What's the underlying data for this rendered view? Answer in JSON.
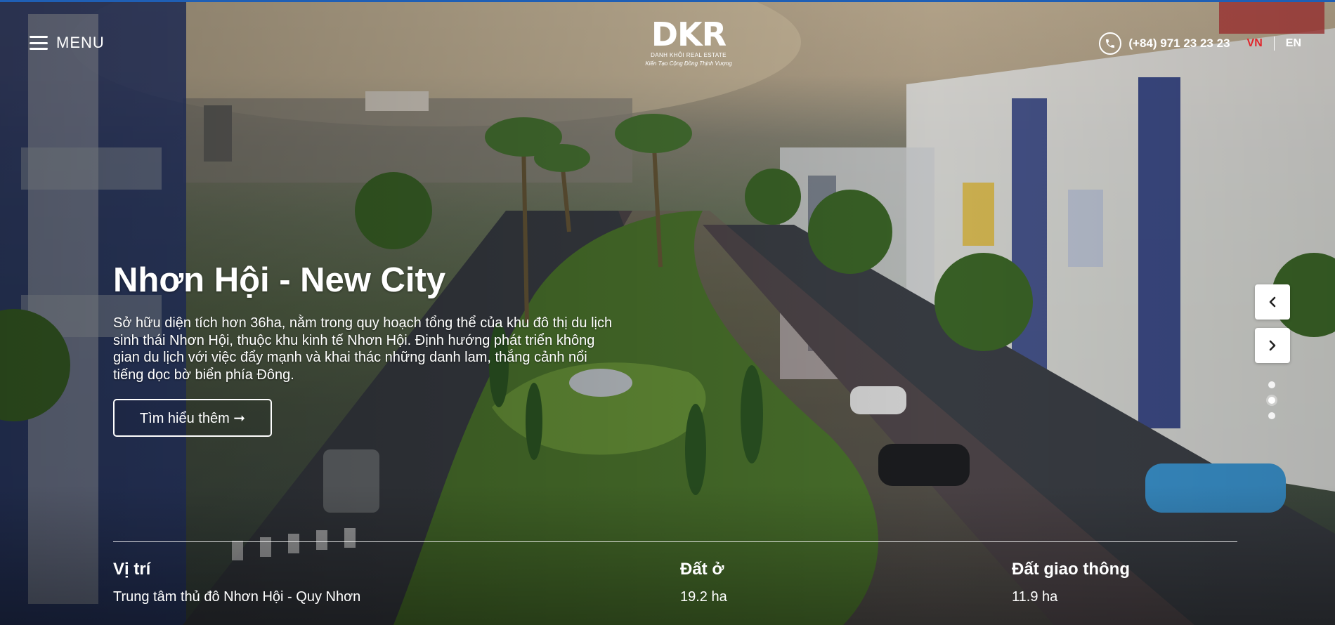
{
  "header": {
    "menu_label": "MENU",
    "logo_mark": "DKR",
    "logo_subtitle": "DANH KHÔI REAL ESTATE",
    "logo_tagline": "Kiến Tạo Cộng Đồng Thịnh Vượng",
    "phone": "(+84) 971 23 23 23",
    "lang_vn": "VN",
    "lang_en": "EN",
    "active_lang": "VN"
  },
  "hero": {
    "title": "Nhơn Hội - New City",
    "description": "Sở hữu diện tích hơn 36ha, nằm trong quy hoạch tổng thể của khu đô thị du lịch sinh thái Nhơn Hội, thuộc khu kinh tế Nhơn Hội. Định hướng phát triển không gian du lịch với việc đẩy mạnh và khai thác những danh lam, thắng cảnh nổi tiếng dọc bờ biển phía Đông.",
    "cta_label": "Tìm hiểu thêm ➞"
  },
  "slider": {
    "slide_count": 3,
    "active_index": 1
  },
  "stats": [
    {
      "label": "Vị trí",
      "value": "Trung tâm thủ đô Nhơn Hội - Quy Nhơn"
    },
    {
      "label": "Đất ở",
      "value": "19.2 ha"
    },
    {
      "label": "Đất giao thông",
      "value": "11.9 ha"
    }
  ],
  "colors": {
    "accent_red": "#e0252b",
    "top_line": "#1f5fb5"
  },
  "icons": [
    "menu-icon",
    "phone-icon",
    "chevron-left-icon",
    "chevron-right-icon"
  ]
}
